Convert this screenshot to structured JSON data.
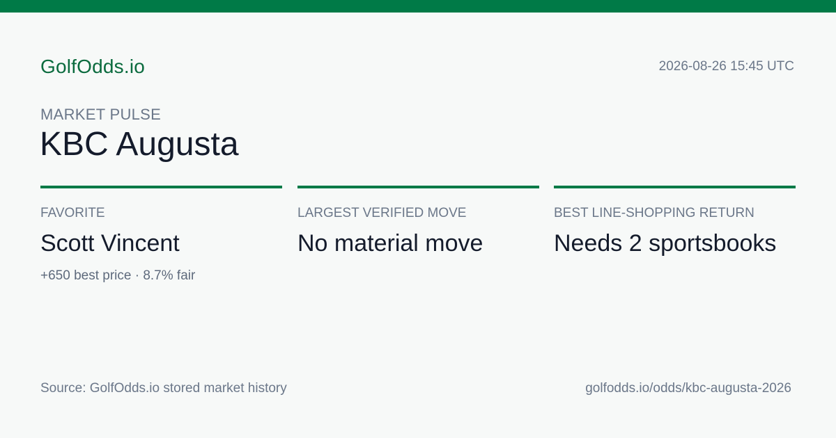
{
  "header": {
    "brand": "GolfOdds.io",
    "timestamp": "2026-08-26 15:45 UTC"
  },
  "hero": {
    "eyebrow": "MARKET PULSE",
    "title": "KBC Augusta"
  },
  "cards": [
    {
      "label": "FAVORITE",
      "value": "Scott Vincent",
      "sub": "+650 best price · 8.7% fair"
    },
    {
      "label": "LARGEST VERIFIED MOVE",
      "value": "No material move",
      "sub": ""
    },
    {
      "label": "BEST LINE-SHOPPING RETURN",
      "value": "Needs 2 sportsbooks",
      "sub": ""
    }
  ],
  "footer": {
    "source": "Source: GolfOdds.io stored market history",
    "url": "golfodds.io/odds/kbc-augusta-2026"
  },
  "colors": {
    "accent": "#007a47",
    "brand": "#0b6b3e",
    "background": "#f7f9f8",
    "text_primary": "#141b2b",
    "text_muted": "#6b7789"
  }
}
